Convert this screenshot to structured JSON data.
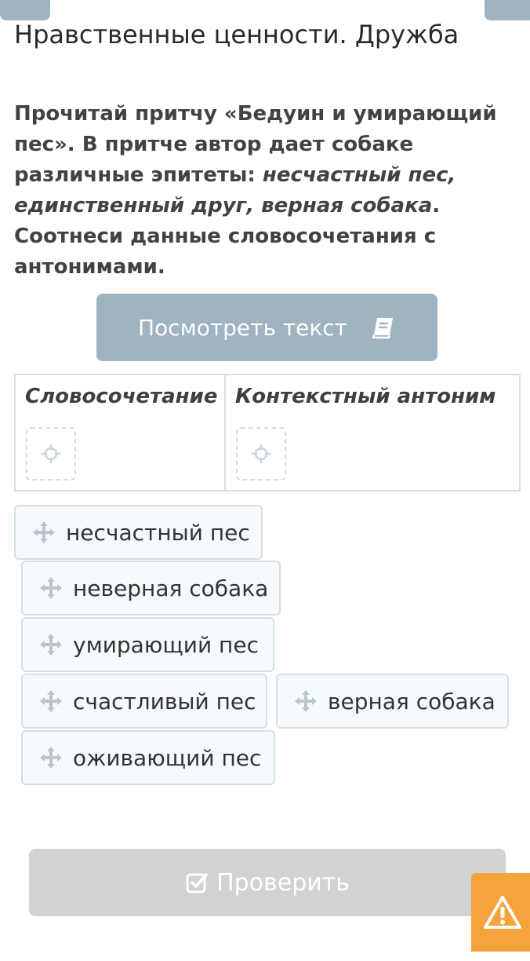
{
  "header": {
    "title": "Нравственные ценности. Дружба"
  },
  "task": {
    "instruction_part1": "Прочитай притчу «Бедуин и умирающий пес». В притче автор дает собаке различные эпитеты: ",
    "instruction_italic": "несчастный пес, единственный друг, верная собака",
    "instruction_part2": ". Соотнеси данные словосочетания с антонимами."
  },
  "view_text_button": {
    "label": "Посмотреть текст",
    "icon": "book-icon"
  },
  "table": {
    "columns": [
      "Словосочетание",
      "Контекстный антоним"
    ]
  },
  "chips": [
    {
      "label": "несчастный пес"
    },
    {
      "label": "неверная собака"
    },
    {
      "label": "умирающий пес"
    },
    {
      "label": "счастливый пес"
    },
    {
      "label": "верная собака"
    },
    {
      "label": "оживающий пес"
    }
  ],
  "check_button": {
    "label": "Проверить",
    "icon": "check-square-icon"
  },
  "warning_button": {
    "icon": "warning-icon"
  },
  "colors": {
    "accent": "#9fb3c0",
    "disabled": "#d2d2d2",
    "warning": "#f5a33a",
    "chip_border": "#d5e0e8"
  }
}
